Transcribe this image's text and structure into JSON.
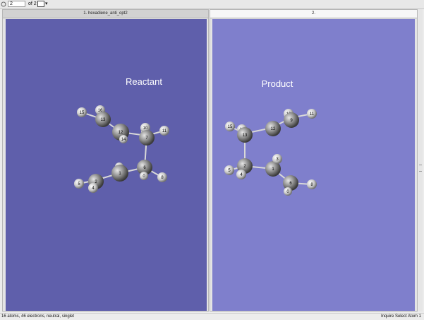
{
  "toolbar": {
    "current_page": "2",
    "of_text": "of 2"
  },
  "panes": [
    {
      "title": "1. hexadiene_anti_opt2",
      "background": "#5f5fab",
      "label": "Reactant",
      "atoms": [
        {
          "n": "15",
          "el": "H"
        },
        {
          "n": "16",
          "el": "H"
        },
        {
          "n": "13",
          "el": "C"
        },
        {
          "n": "12",
          "el": "C"
        },
        {
          "n": "14",
          "el": "H"
        },
        {
          "n": "9",
          "el": "H"
        },
        {
          "n": "10",
          "el": "H"
        },
        {
          "n": "7",
          "el": "C"
        },
        {
          "n": "11",
          "el": "H"
        },
        {
          "n": "3",
          "el": "H"
        },
        {
          "n": "2",
          "el": "C"
        },
        {
          "n": "5",
          "el": "H"
        },
        {
          "n": "4",
          "el": "H"
        },
        {
          "n": "1",
          "el": "C"
        },
        {
          "n": "6",
          "el": "C"
        },
        {
          "n": "0",
          "el": "H"
        },
        {
          "n": "8",
          "el": "H"
        }
      ]
    },
    {
      "title": "2.",
      "background": "#7f7fcc",
      "label": "Product",
      "atoms": [
        {
          "n": "15",
          "el": "H"
        },
        {
          "n": "16",
          "el": "H"
        },
        {
          "n": "13",
          "el": "C"
        },
        {
          "n": "12",
          "el": "C"
        },
        {
          "n": "10",
          "el": "H"
        },
        {
          "n": "11",
          "el": "H"
        },
        {
          "n": "9",
          "el": "C"
        },
        {
          "n": "2",
          "el": "C"
        },
        {
          "n": "5",
          "el": "H"
        },
        {
          "n": "4",
          "el": "H"
        },
        {
          "n": "1",
          "el": "C"
        },
        {
          "n": "3",
          "el": "H"
        },
        {
          "n": "6",
          "el": "C"
        },
        {
          "n": "8",
          "el": "H"
        },
        {
          "n": "0",
          "el": "H"
        }
      ]
    }
  ],
  "status": {
    "left": "16 atoms, 46 electrons, neutral, singlet",
    "right": "Inquire  Select Atom 1"
  }
}
